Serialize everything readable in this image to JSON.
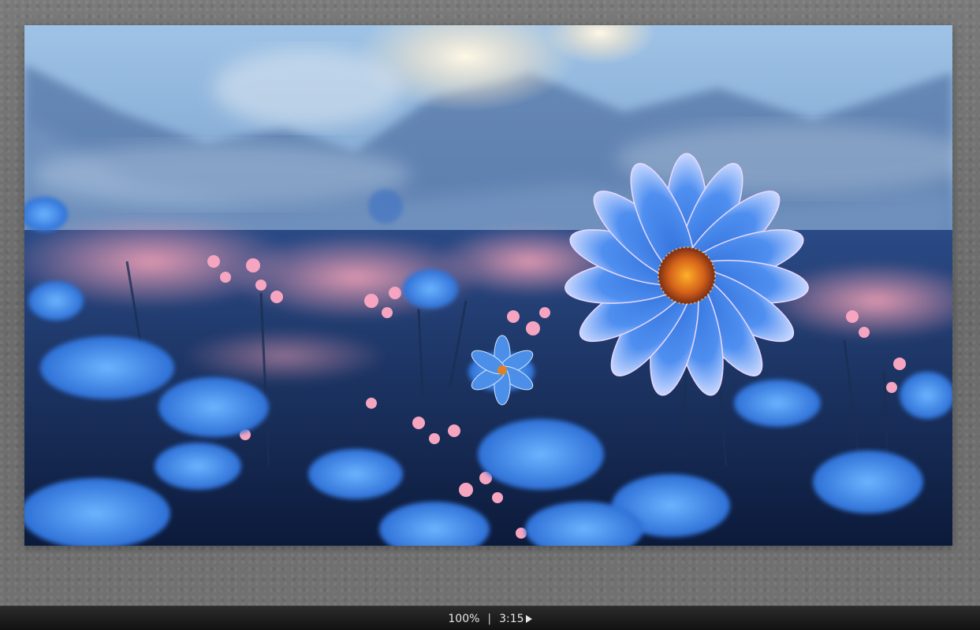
{
  "image_viewer": {
    "zoom": "100%",
    "separator": "|",
    "duration": "3:15",
    "play_icon": "play-icon"
  },
  "colors": {
    "background": "#6f6f6f",
    "statusbar": "#1a1a1a",
    "text": "#e6e6e6"
  }
}
